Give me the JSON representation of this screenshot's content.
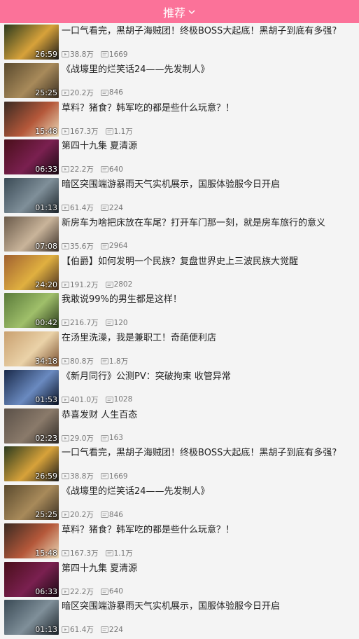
{
  "header": {
    "title": "推荐",
    "chevron_icon": "chevron-down-icon"
  },
  "icons": {
    "play": "play-icon",
    "comment": "comment-icon"
  },
  "colors": {
    "brand": "#fb7299"
  },
  "videos": [
    {
      "title": "一口气看完，黑胡子海贼团！终极BOSS大起底！黑胡子到底有多强?",
      "duration": "26:59",
      "plays": "38.8万",
      "comments": "1669",
      "thumb": [
        "#2a3a1e",
        "#d7a23a",
        "#1a1a1a"
      ]
    },
    {
      "title": "《战壕里的烂笑话24——先发制人》",
      "duration": "25:25",
      "plays": "20.2万",
      "comments": "846",
      "thumb": [
        "#5a4a2e",
        "#a88a5a",
        "#3a2f22"
      ]
    },
    {
      "title": "草料？猪食？韩军吃的都是些什么玩意？！",
      "duration": "15:48",
      "plays": "167.3万",
      "comments": "1.1万",
      "thumb": [
        "#3a2a22",
        "#b5583a",
        "#e9d9b8"
      ]
    },
    {
      "title": "第四十九集 夏清源",
      "duration": "06:33",
      "plays": "22.2万",
      "comments": "640",
      "thumb": [
        "#4a0f1a",
        "#7a2050",
        "#1a0a12"
      ]
    },
    {
      "title": "暗区突围端游暴雨天气实机展示，国服体验服今日开启",
      "duration": "01:13",
      "plays": "61.4万",
      "comments": "224",
      "thumb": [
        "#3a4a55",
        "#7f8f99",
        "#1e262c"
      ]
    },
    {
      "title": "新房车为啥把床放在车尾？打开车门那一刻，就是房车旅行的意义",
      "duration": "07:08",
      "plays": "35.6万",
      "comments": "2964",
      "thumb": [
        "#6a5a4a",
        "#c9b49a",
        "#3a3029"
      ]
    },
    {
      "title": "【伯爵】如何发明一个民族？复盘世界史上三波民族大觉醒",
      "duration": "24:20",
      "plays": "191.2万",
      "comments": "2802",
      "thumb": [
        "#a06030",
        "#e0b040",
        "#4a3020"
      ]
    },
    {
      "title": "我敢说99%的男生都是这样！",
      "duration": "00:42",
      "plays": "216.7万",
      "comments": "120",
      "thumb": [
        "#5a7a3a",
        "#9fbf6a",
        "#2a3a1a"
      ]
    },
    {
      "title": "在汤里洗澡，我是兼职工！奇葩便利店",
      "duration": "34:18",
      "plays": "80.8万",
      "comments": "1.8万",
      "thumb": [
        "#c9a070",
        "#ead2a8",
        "#7a5030"
      ]
    },
    {
      "title": "《新月同行》公测PV：突破拘束 收管异常",
      "duration": "01:53",
      "plays": "401.0万",
      "comments": "1028",
      "thumb": [
        "#1a2a4a",
        "#6a8ac0",
        "#0a1224"
      ]
    },
    {
      "title": "恭喜发财 人生百态",
      "duration": "02:23",
      "plays": "29.0万",
      "comments": "163",
      "thumb": [
        "#5a5048",
        "#8a7a6a",
        "#2f2a26"
      ]
    },
    {
      "title": "一口气看完，黑胡子海贼团！终极BOSS大起底！黑胡子到底有多强?",
      "duration": "26:59",
      "plays": "38.8万",
      "comments": "1669",
      "thumb": [
        "#2a3a1e",
        "#d7a23a",
        "#1a1a1a"
      ]
    },
    {
      "title": "《战壕里的烂笑话24——先发制人》",
      "duration": "25:25",
      "plays": "20.2万",
      "comments": "846",
      "thumb": [
        "#5a4a2e",
        "#a88a5a",
        "#3a2f22"
      ]
    },
    {
      "title": "草料？猪食？韩军吃的都是些什么玩意？！",
      "duration": "15:48",
      "plays": "167.3万",
      "comments": "1.1万",
      "thumb": [
        "#3a2a22",
        "#b5583a",
        "#e9d9b8"
      ]
    },
    {
      "title": "第四十九集 夏清源",
      "duration": "06:33",
      "plays": "22.2万",
      "comments": "640",
      "thumb": [
        "#4a0f1a",
        "#7a2050",
        "#1a0a12"
      ]
    },
    {
      "title": "暗区突围端游暴雨天气实机展示，国服体验服今日开启",
      "duration": "01:13",
      "plays": "61.4万",
      "comments": "224",
      "thumb": [
        "#3a4a55",
        "#7f8f99",
        "#1e262c"
      ]
    }
  ]
}
